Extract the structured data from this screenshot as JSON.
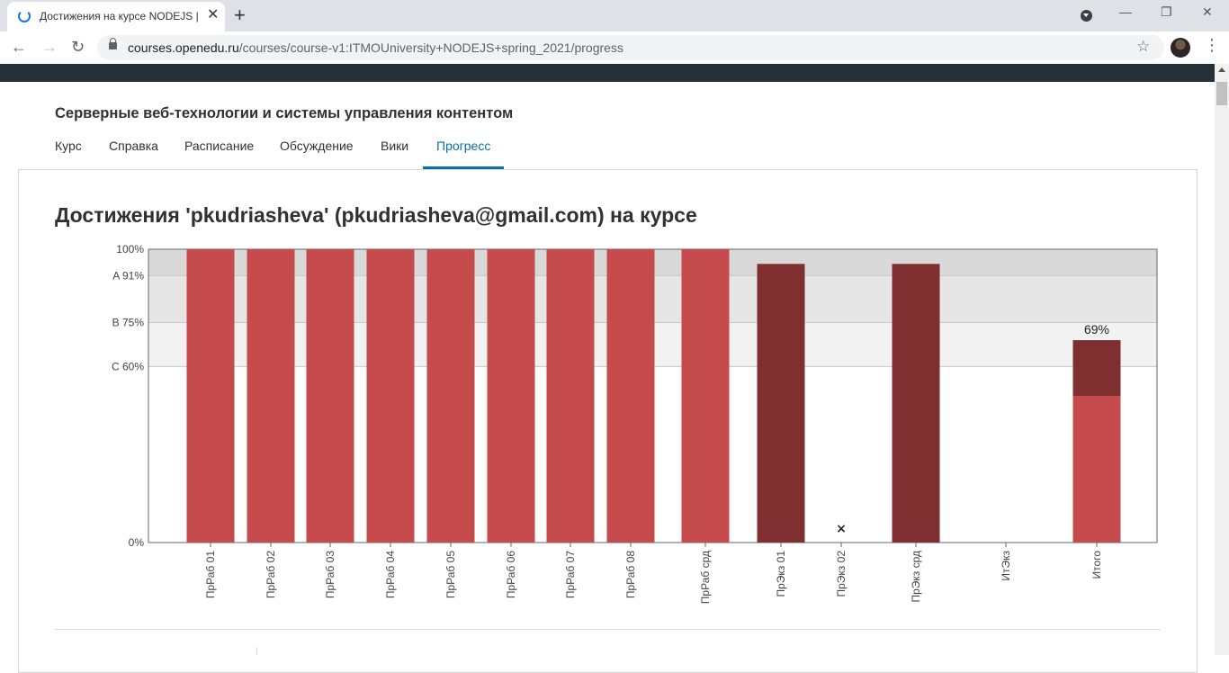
{
  "browser": {
    "tab_title": "Достижения на курсе NODEJS |",
    "url_host": "courses.openedu.ru",
    "url_path": "/courses/course-v1:ITMOUniversity+NODEJS+spring_2021/progress"
  },
  "course": {
    "title": "Серверные веб-технологии и системы управления контентом",
    "nav": [
      "Курс",
      "Справка",
      "Расписание",
      "Обсуждение",
      "Вики",
      "Прогресс"
    ],
    "active_nav": "Прогресс"
  },
  "progress": {
    "title": "Достижения 'pkudriasheva' (pkudriasheva@gmail.com) на курсе"
  },
  "chart_data": {
    "type": "bar",
    "ylim": [
      0,
      100
    ],
    "ytick_labels": [
      {
        "label": "100%",
        "value": 100
      },
      {
        "label": "A 91%",
        "value": 91
      },
      {
        "label": "B 75%",
        "value": 75
      },
      {
        "label": "C 60%",
        "value": 60
      },
      {
        "label": "0%",
        "value": 0
      }
    ],
    "grade_bands": [
      {
        "from": 91,
        "to": 100,
        "color": "#d9d9d9"
      },
      {
        "from": 75,
        "to": 91,
        "color": "#e6e6e6"
      },
      {
        "from": 60,
        "to": 75,
        "color": "#f2f2f2"
      }
    ],
    "categories": [
      "ПрРаб 01",
      "ПрРаб 02",
      "ПрРаб 03",
      "ПрРаб 04",
      "ПрРаб 05",
      "ПрРаб 06",
      "ПрРаб 07",
      "ПрРаб 08",
      "ПрРаб срд",
      "ПрЭкз 01",
      "ПрЭкз 02",
      "ПрЭкз срд",
      "ИтЭкз",
      "Итого"
    ],
    "values": [
      100,
      100,
      100,
      100,
      100,
      100,
      100,
      100,
      100,
      95,
      0,
      95,
      0,
      69
    ],
    "colors": [
      "#c64b4c",
      "#c64b4c",
      "#c64b4c",
      "#c64b4c",
      "#c64b4c",
      "#c64b4c",
      "#c64b4c",
      "#c64b4c",
      "#c64b4c",
      "#7f2f30",
      "#7f2f30",
      "#7f2f30",
      "#7f2f30",
      "#7f2f30"
    ],
    "dropped_marker": {
      "category": "ПрЭкз 02",
      "symbol": "×"
    },
    "total": {
      "category": "Итого",
      "label": "69%",
      "segments": [
        {
          "value": 50,
          "color": "#c64b4c"
        },
        {
          "value": 19,
          "color": "#7f2f30"
        }
      ]
    }
  }
}
